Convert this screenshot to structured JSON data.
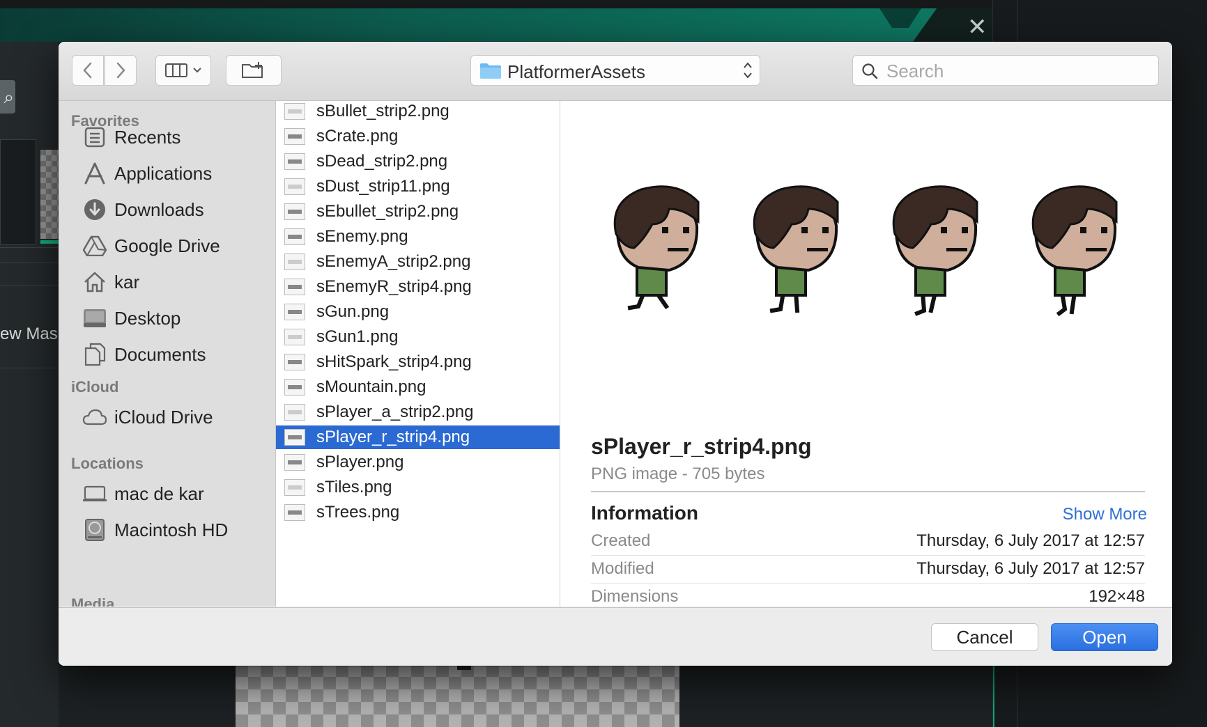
{
  "background_app": {
    "left_text": "ew Mas",
    "close_glyph": "✕",
    "left_button_glyph": "⌕"
  },
  "toolbar": {
    "back_icon": "chevron-left-icon",
    "forward_icon": "chevron-right-icon",
    "view_icon": "column-view-icon",
    "new_folder_icon": "new-folder-icon",
    "path_popup_label": "PlatformerAssets",
    "search_placeholder": "Search"
  },
  "sidebar": {
    "sections": [
      {
        "title": "Favorites"
      },
      {
        "title": "iCloud"
      },
      {
        "title": "Locations"
      },
      {
        "title": "Media"
      }
    ],
    "favorites": [
      {
        "label": "Recents",
        "icon": "recents-icon"
      },
      {
        "label": "Applications",
        "icon": "applications-icon"
      },
      {
        "label": "Downloads",
        "icon": "downloads-icon"
      },
      {
        "label": "Google Drive",
        "icon": "google-drive-icon"
      },
      {
        "label": "kar",
        "icon": "home-icon"
      },
      {
        "label": "Desktop",
        "icon": "desktop-icon"
      },
      {
        "label": "Documents",
        "icon": "documents-icon"
      }
    ],
    "icloud": [
      {
        "label": "iCloud Drive",
        "icon": "cloud-icon"
      }
    ],
    "locations": [
      {
        "label": "mac de kar",
        "icon": "laptop-icon"
      },
      {
        "label": "Macintosh HD",
        "icon": "hard-drive-icon"
      }
    ]
  },
  "files": [
    {
      "name": "sBullet_strip2.png",
      "selected": false
    },
    {
      "name": "sCrate.png",
      "selected": false
    },
    {
      "name": "sDead_strip2.png",
      "selected": false
    },
    {
      "name": "sDust_strip11.png",
      "selected": false
    },
    {
      "name": "sEbullet_strip2.png",
      "selected": false
    },
    {
      "name": "sEnemy.png",
      "selected": false
    },
    {
      "name": "sEnemyA_strip2.png",
      "selected": false
    },
    {
      "name": "sEnemyR_strip4.png",
      "selected": false
    },
    {
      "name": "sGun.png",
      "selected": false
    },
    {
      "name": "sGun1.png",
      "selected": false
    },
    {
      "name": "sHitSpark_strip4.png",
      "selected": false
    },
    {
      "name": "sMountain.png",
      "selected": false
    },
    {
      "name": "sPlayer_a_strip2.png",
      "selected": false
    },
    {
      "name": "sPlayer_r_strip4.png",
      "selected": true
    },
    {
      "name": "sPlayer.png",
      "selected": false
    },
    {
      "name": "sTiles.png",
      "selected": false
    },
    {
      "name": "sTrees.png",
      "selected": false
    }
  ],
  "preview": {
    "title": "sPlayer_r_strip4.png",
    "subtitle": "PNG image - 705 bytes",
    "info_heading": "Information",
    "show_more": "Show More",
    "rows": [
      {
        "key": "Created",
        "value": "Thursday, 6 July 2017 at 12:57"
      },
      {
        "key": "Modified",
        "value": "Thursday, 6 July 2017 at 12:57"
      },
      {
        "key": "Dimensions",
        "value": "192×48"
      }
    ],
    "colors": {
      "hair": "#3b2a24",
      "skin": "#cfae9c",
      "shirt": "#5f8a4a",
      "outline": "#111111"
    }
  },
  "footer": {
    "cancel_label": "Cancel",
    "open_label": "Open"
  },
  "colors": {
    "selection": "#2b6ad3",
    "accent_link": "#2e6fd6",
    "teal": "#0e7a63"
  }
}
